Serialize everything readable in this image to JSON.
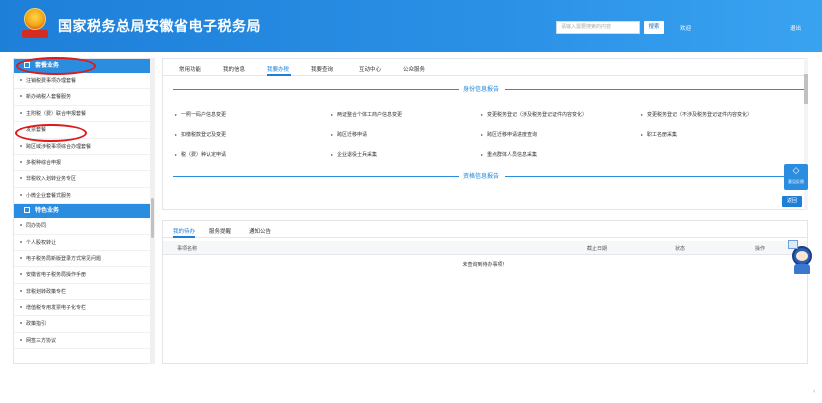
{
  "header": {
    "title": "国家税务总局安徽省电子税务局",
    "emblem_caption": "TAXES",
    "search_placeholder": "请输入需要搜索的内容",
    "search_button": "搜索",
    "welcome": "欢迎",
    "logout": "退出"
  },
  "sidebar": {
    "sections": [
      {
        "title": "套餐业务",
        "items": [
          "注销税费事项办理套餐",
          "新办纳税人套餐服务",
          "主附税（费）联合申报套餐",
          "发票套餐",
          "跨区域涉税事项综合办理套餐",
          "多税种综合申报",
          "非税收入划转业务专区",
          "小微企业套餐式服务"
        ]
      },
      {
        "title": "特色业务",
        "items": [
          "同办协同",
          "个人股权转让",
          "电子税务局新版登录方式常见问题",
          "安徽省电子税务局操作手册",
          "非税划转政策专栏",
          "增值税专用发票电子化专栏",
          "政策指引",
          "网签三方协议"
        ]
      }
    ]
  },
  "main": {
    "tabs": [
      "常用功能",
      "我的信息",
      "我要办税",
      "我要查询",
      "互动中心",
      "公众服务"
    ],
    "active_tab": "我要办税",
    "section_identity": "身份信息报告",
    "identity_links": [
      "一照一码户信息变更",
      "两证整合个体工商户信息变更",
      "变更税务登记（涉及税务登记证件内容变化）",
      "变更税务登记（不涉及税务登记证件内容变化）",
      "扣缴税款登记及变更",
      "跨区迁移申请",
      "跨区迁移申请进度查询",
      "职工名册采集",
      "税（费）种认定申请",
      "企业退役士兵采集",
      "重点群体人员信息采集"
    ],
    "section_qualification": "资格信息报告"
  },
  "feedback_label": "意见反馈",
  "back_button": "返回",
  "todo": {
    "tabs": [
      "我的待办",
      "服务提醒",
      "通知公告"
    ],
    "columns": [
      "事项名称",
      "截止日期",
      "状态",
      "操作"
    ],
    "empty_text": "未查询到待办事项！"
  },
  "mascot_label": "税小安",
  "colors": {
    "brand_blue": "#1e7fd8",
    "header_blue": "#2a90e6",
    "annotation_red": "#e01818"
  }
}
